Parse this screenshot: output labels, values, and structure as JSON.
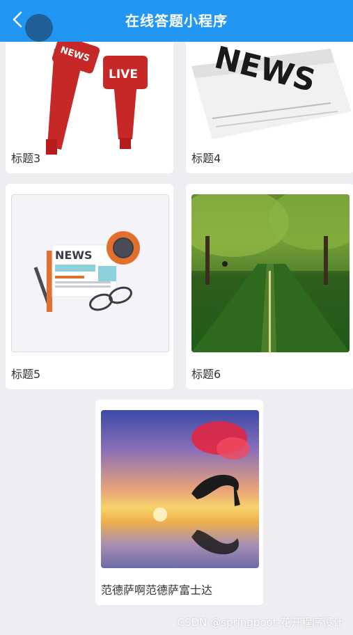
{
  "header": {
    "title": "在线答题小程序"
  },
  "cards": [
    {
      "label": "标题3"
    },
    {
      "label": "标题4"
    },
    {
      "label": "标题5"
    },
    {
      "label": "标题6"
    },
    {
      "label": "范德萨啊范德萨富士达"
    }
  ],
  "images": {
    "card3_text": "LIVE",
    "card3_text2": "NEWS",
    "card4_text": "NEWS",
    "card5_text": "NEWS"
  },
  "watermark": "CSDN @springboot-花开程序设计",
  "colors": {
    "header": "#2196f3",
    "background": "#eeeef2"
  }
}
